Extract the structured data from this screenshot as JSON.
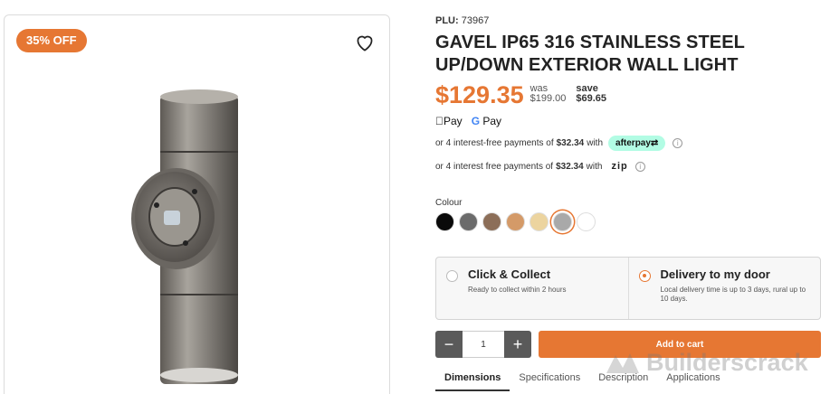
{
  "badge": {
    "label": "35% OFF"
  },
  "product": {
    "plu_label": "PLU:",
    "plu_value": "73967",
    "title": "GAVEL IP65 316 STAINLESS STEEL UP/DOWN EXTERIOR WALL LIGHT",
    "price": "$129.35",
    "was_label": "was",
    "was_price": "$199.00",
    "save_label": "save",
    "save_amount": "$69.65"
  },
  "payments": {
    "apple_pay": "Pay",
    "google_pay_g": "G",
    "google_pay_text": "Pay",
    "afterpay_text_pre": "or 4 interest-free payments of",
    "afterpay_amount": "$32.34",
    "afterpay_text_post": "with",
    "afterpay_logo": "afterpay⇄",
    "zip_text_pre": "or 4 interest free payments of",
    "zip_amount": "$32.34",
    "zip_text_post": "with",
    "zip_logo": "zip",
    "info_glyph": "i"
  },
  "colour": {
    "label": "Colour",
    "swatches": [
      "#0a0a0a",
      "#6b6b6b",
      "#8c6e58",
      "#d49a68",
      "#ecd49f",
      "#a9a9a9",
      "#ffffff"
    ],
    "selected_index": 5
  },
  "delivery": {
    "click_collect_title": "Click & Collect",
    "click_collect_sub": "Ready to collect within 2 hours",
    "delivery_title": "Delivery to my door",
    "delivery_sub": "Local delivery time is up to 3 days, rural up to 10 days."
  },
  "cart": {
    "minus": "−",
    "plus": "+",
    "quantity": "1",
    "add_label": "Add to cart"
  },
  "tabs": [
    "Dimensions",
    "Specifications",
    "Description",
    "Applications"
  ],
  "watermark": "Builderscrack",
  "colors": {
    "accent": "#e67733",
    "afterpay": "#b2fce4"
  }
}
